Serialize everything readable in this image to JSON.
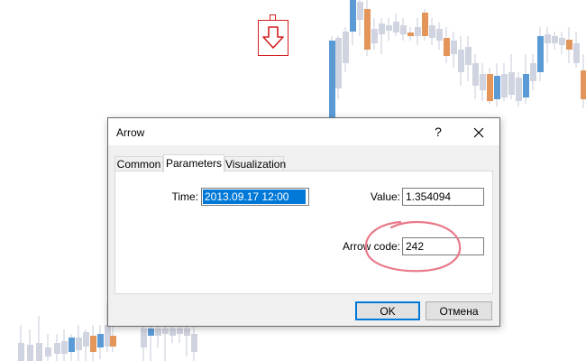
{
  "dialog": {
    "title": "Arrow",
    "help_label": "?",
    "close_label": "✕"
  },
  "tabs": [
    {
      "label": "Common",
      "active": false
    },
    {
      "label": "Parameters",
      "active": true
    },
    {
      "label": "Visualization",
      "active": false
    }
  ],
  "parameters": {
    "time_label": "Time:",
    "time_value": "2013.09.17 12:00",
    "value_label": "Value:",
    "value_value": "1.354094",
    "arrow_code_label": "Arrow code:",
    "arrow_code_value": "242"
  },
  "buttons": {
    "ok_label": "OK",
    "cancel_label": "Отмена"
  },
  "colors": {
    "bull_candle": "#5b9bd5",
    "bear_candle": "#e3955a",
    "neutral_candle": "#d0d4e0",
    "arrow_object": "#d32020",
    "highlight_ring": "#e87a8a",
    "accent": "#0078d7"
  }
}
